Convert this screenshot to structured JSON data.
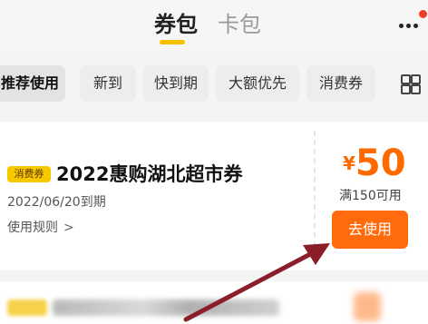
{
  "tabs": [
    {
      "label": "券包",
      "active": true
    },
    {
      "label": "卡包",
      "active": false
    }
  ],
  "filters": [
    {
      "label": "推荐使用",
      "active": true
    },
    {
      "label": "新到",
      "active": false
    },
    {
      "label": "快到期",
      "active": false
    },
    {
      "label": "大额优先",
      "active": false
    },
    {
      "label": "消费券",
      "active": false
    }
  ],
  "coupon": {
    "tag": "消费券",
    "title": "2022惠购湖北超市券",
    "expiry": "2022/06/20到期",
    "rules_label": "使用规则",
    "currency": "¥",
    "amount": "50",
    "condition": "满150可用",
    "use_label": "去使用"
  },
  "icons": [
    "more-icon",
    "notification-dot-icon",
    "grid-icon",
    "chevron-right-icon",
    "arrow-pointer-icon"
  ],
  "colors": {
    "accent": "#ff6b0d",
    "highlight": "#f9c700",
    "arrow": "#8a1f2a"
  }
}
